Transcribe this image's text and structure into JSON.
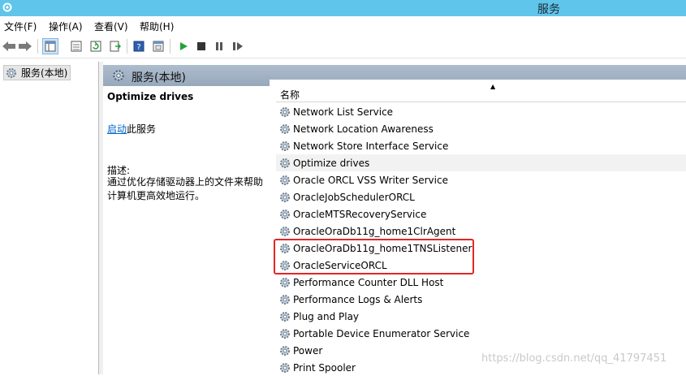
{
  "window": {
    "title": "服务"
  },
  "menu": [
    "文件(F)",
    "操作(A)",
    "查看(V)",
    "帮助(H)"
  ],
  "toolbar": {
    "buttons": [
      "back-icon",
      "forward-icon",
      "show-hide-tree-icon",
      "properties-icon",
      "refresh-icon",
      "export-list-icon",
      "help-icon",
      "console-icon",
      "start-service-icon",
      "stop-service-icon",
      "pause-service-icon",
      "restart-service-icon"
    ]
  },
  "tree": {
    "item": "服务(本地)"
  },
  "header": {
    "title": "服务(本地)"
  },
  "details": {
    "service_name": "Optimize drives",
    "start_link": "启动",
    "start_suffix": "此服务",
    "desc_label": "描述:",
    "desc_text": "通过优化存储驱动器上的文件来帮助计算机更高效地运行。"
  },
  "list": {
    "column_name": "名称",
    "services": [
      "Network List Service",
      "Network Location Awareness",
      "Network Store Interface Service",
      "Optimize drives",
      "Oracle ORCL VSS Writer Service",
      "OracleJobSchedulerORCL",
      "OracleMTSRecoveryService",
      "OracleOraDb11g_home1ClrAgent",
      "OracleOraDb11g_home1TNSListener",
      "OracleServiceORCL",
      "Performance Counter DLL Host",
      "Performance Logs & Alerts",
      "Plug and Play",
      "Portable Device Enumerator Service",
      "Power",
      "Print Spooler"
    ],
    "selected": "Optimize drives"
  },
  "watermark": "https://blog.csdn.net/qq_41797451",
  "colors": {
    "titlebar": "#5fc5ea",
    "header": "#a3b3c5",
    "highlight": "#e32626",
    "link": "#0066cc"
  }
}
